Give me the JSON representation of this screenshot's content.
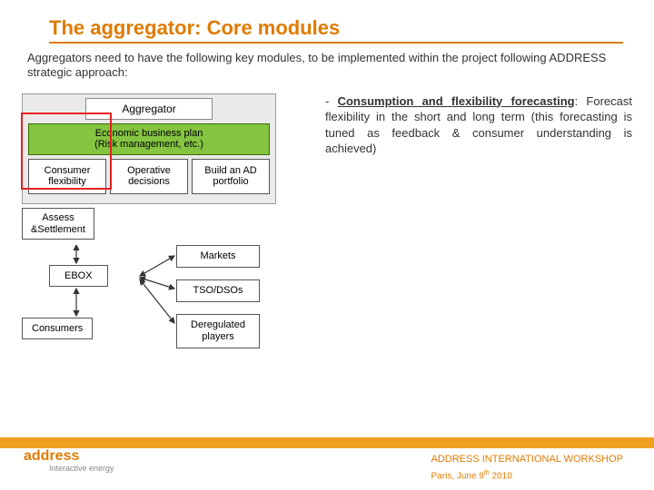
{
  "title": "The aggregator: Core modules",
  "intro": "Aggregators need to have the following key modules, to be implemented within the project following ADDRESS strategic approach:",
  "bullet": {
    "dash": "- ",
    "label": "Consumption and flexibility forecasting",
    "rest": ": Forecast flexibility in the short and long term (this forecasting is tuned as feedback & consumer understanding is achieved)"
  },
  "diagram": {
    "aggregator_title": "Aggregator",
    "business_plan_line1": "Economic business plan",
    "business_plan_line2": "(Risk management, etc.)",
    "modules": {
      "flexibility": "Consumer flexibility",
      "operative": "Operative decisions",
      "portfolio": "Build an AD portfolio"
    },
    "assess": "Assess &Settlement",
    "ebox": "EBOX",
    "consumers": "Consumers",
    "markets": "Markets",
    "tso": "TSO/DSOs",
    "dereg": "Deregulated players",
    "highlighted_module": "flexibility"
  },
  "footer": {
    "logo": "address",
    "logo_sub": "Interactive energy",
    "workshop": "ADDRESS INTERNATIONAL WORKSHOP",
    "location": "Paris, June 9",
    "location_sup": "th",
    "location_year": " 2010"
  }
}
